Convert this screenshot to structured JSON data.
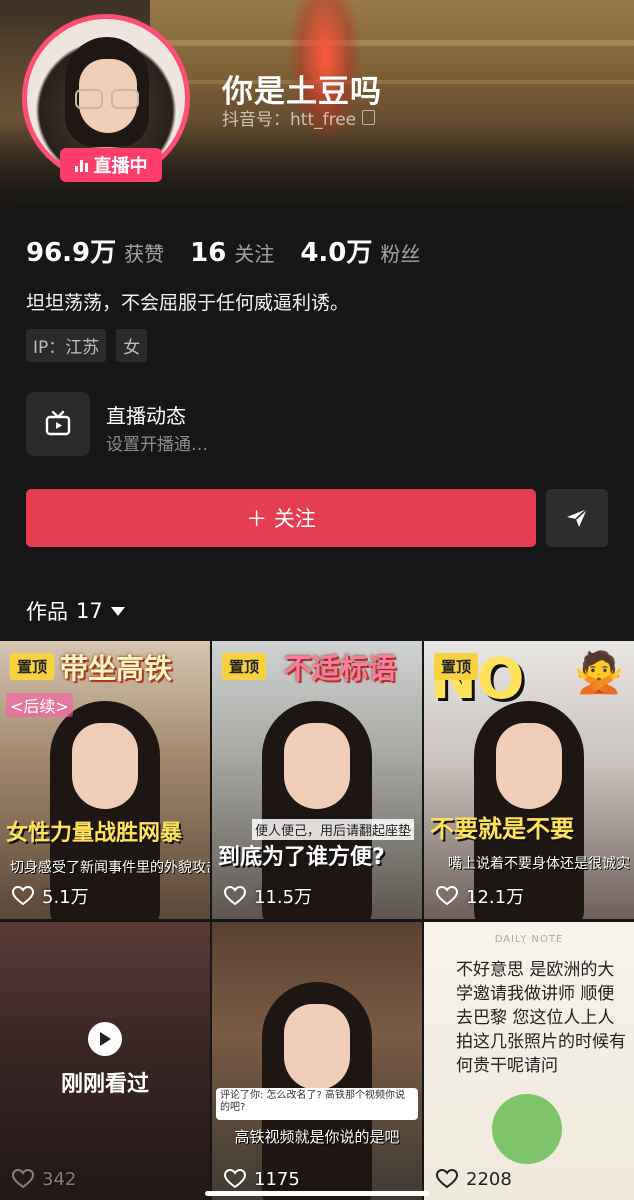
{
  "profile": {
    "nickname": "你是土豆吗",
    "douyin_id": "抖音号：htt_free",
    "live_badge": "直播中",
    "likes_count": "96.9万",
    "likes_label": "获赞",
    "following_count": "16",
    "following_label": "关注",
    "followers_count": "4.0万",
    "followers_label": "粉丝",
    "bio": "坦坦荡荡，不会屈服于任何威逼利诱。",
    "tags": [
      "IP：江苏",
      "女"
    ]
  },
  "live_dynamics": {
    "title": "直播动态",
    "subtitle": "设置开播通…"
  },
  "actions": {
    "follow_label": "＋ 关注"
  },
  "works_tab": {
    "label": "作品",
    "count": "17"
  },
  "videos": [
    {
      "pinned": "置顶",
      "title": "带坐高铁",
      "subtitle": "<后续>",
      "big_text": "女性力量战胜网暴",
      "small_text": "切身感受了新闻事件里的外貌攻击",
      "likes": "5.1万"
    },
    {
      "pinned": "置顶",
      "title": "不适标语",
      "big_text": "到底为了谁方便?",
      "small_text": "便人便己，用后请翻起座垫",
      "likes": "11.5万"
    },
    {
      "pinned": "置顶",
      "title": "NO",
      "big_text": "不要就是不要",
      "small_text": "嘴上说着不要身体还是很诚实",
      "likes": "12.1万"
    },
    {
      "overlay": "刚刚看过",
      "likes": "342"
    },
    {
      "comment": "评论了你: 怎么改名了? 高铁那个视频你说的吧?",
      "caption": "高铁视频就是你说的是吧",
      "likes": "1175"
    },
    {
      "note_header": "DAILY NOTE",
      "note_text": "不好意思 是欧洲的大学邀请我做讲师 顺便去巴黎 您这位人上人拍这几张照片的时候有何贵干呢请问",
      "likes": "2208"
    }
  ],
  "colors": {
    "accent": "#e53e52",
    "live": "#fd3e6d",
    "background": "#161616"
  }
}
